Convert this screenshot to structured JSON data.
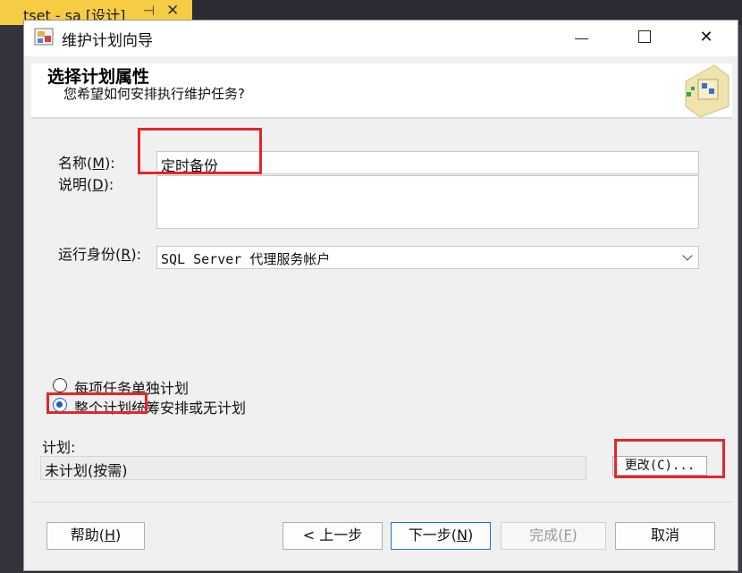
{
  "background": {
    "tab_title": "tset - sa [设计]",
    "pin_glyph": "⊣",
    "close_glyph": "✕"
  },
  "window": {
    "title": "维护计划向导",
    "app_icon": "wizard-app-icon",
    "minimize_icon": "minimize-icon",
    "maximize_icon": "maximize-icon",
    "close_glyph": "✕"
  },
  "header": {
    "title": "选择计划属性",
    "subtitle": "您希望如何安排执行维护任务?"
  },
  "form": {
    "name_label": "名称",
    "name_accel": "(M)",
    "name_accel_key": "M",
    "name_colon": ":",
    "name_value": "定时备份",
    "desc_label": "说明",
    "desc_accel_key": "D",
    "desc_colon": ":",
    "desc_value": "",
    "run_as_label": "运行身份",
    "run_as_accel_key": "R",
    "run_as_colon": ":",
    "run_as_value": "SQL Server 代理服务帐户"
  },
  "schedule_options": [
    {
      "label": "每项任务单独计划",
      "checked": false
    },
    {
      "label": "整个计划统筹安排或无计划",
      "checked": true
    }
  ],
  "plan": {
    "label": "计划:",
    "value": "未计划(按需)",
    "change_button": "更改(C)..."
  },
  "buttons": {
    "help": "帮助",
    "help_accel_key": "H",
    "back": "上一步",
    "back_glyph": "<",
    "next": "下一步",
    "next_accel_key": "N",
    "finish": "完成",
    "finish_accel_key": "F",
    "cancel": "取消"
  },
  "annotation_color": "#e3262b"
}
